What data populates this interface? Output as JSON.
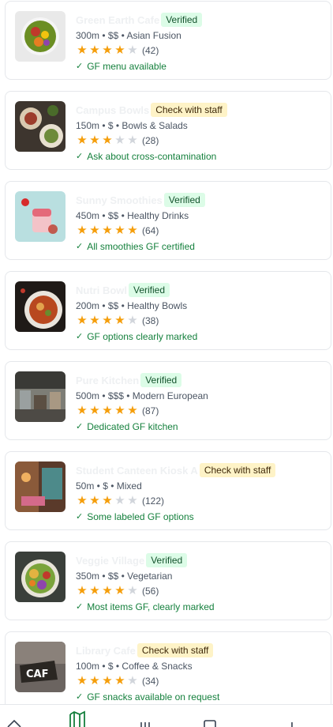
{
  "restaurants": [
    {
      "name": "Green Earth Cafe",
      "badge": "Verified",
      "badge_type": "verified",
      "meta": "300m • $$ • Asian Fusion",
      "rating": 4,
      "reviews": "(42)",
      "gf_note": "GF menu available",
      "thumb": "salad-bowl"
    },
    {
      "name": "Campus Bowls",
      "badge": "Check with staff",
      "badge_type": "check",
      "meta": "150m • $ • Bowls & Salads",
      "rating": 3,
      "reviews": "(28)",
      "gf_note": "Ask about cross-contamination",
      "thumb": "plated-dishes"
    },
    {
      "name": "Sunny Smoothies",
      "badge": "Verified",
      "badge_type": "verified",
      "meta": "450m • $$ • Healthy Drinks",
      "rating": 5,
      "reviews": "(64)",
      "gf_note": "All smoothies GF certified",
      "thumb": "smoothie"
    },
    {
      "name": "Nutri Bowl",
      "badge": "Verified",
      "badge_type": "verified",
      "meta": "200m • $$ • Healthy Bowls",
      "rating": 4,
      "reviews": "(38)",
      "gf_note": "GF options clearly marked",
      "thumb": "curry-bowl"
    },
    {
      "name": "Pure Kitchen",
      "badge": "Verified",
      "badge_type": "verified",
      "meta": "500m • $$$ • Modern European",
      "rating": 5,
      "reviews": "(87)",
      "gf_note": "Dedicated GF kitchen",
      "thumb": "restaurant-interior"
    },
    {
      "name": "Student Canteen Kiosk A",
      "badge": "Check with staff",
      "badge_type": "check",
      "meta": "50m • $ • Mixed",
      "rating": 3,
      "reviews": "(122)",
      "gf_note": "Some labeled GF options",
      "thumb": "kiosk"
    },
    {
      "name": "Veggie Village",
      "badge": "Verified",
      "badge_type": "verified",
      "meta": "350m • $$ • Vegetarian",
      "rating": 4,
      "reviews": "(56)",
      "gf_note": "Most items GF, clearly marked",
      "thumb": "veggie-bowl"
    },
    {
      "name": "Library Cafe",
      "badge": "Check with staff",
      "badge_type": "check",
      "meta": "100m • $ • Coffee & Snacks",
      "rating": 4,
      "reviews": "(34)",
      "gf_note": "GF snacks available on request",
      "thumb": "cafe-sign"
    }
  ],
  "nav": [
    {
      "icon": "home-icon",
      "active": false
    },
    {
      "icon": "map-icon",
      "active": true
    },
    {
      "icon": "list-icon",
      "active": false
    },
    {
      "icon": "bookmark-icon",
      "active": false
    },
    {
      "icon": "plus-icon",
      "active": false
    }
  ],
  "colors": {
    "accent": "#15803d",
    "star": "#f59e0b",
    "verified_bg": "#dcfce7",
    "check_bg": "#fef3c7"
  }
}
